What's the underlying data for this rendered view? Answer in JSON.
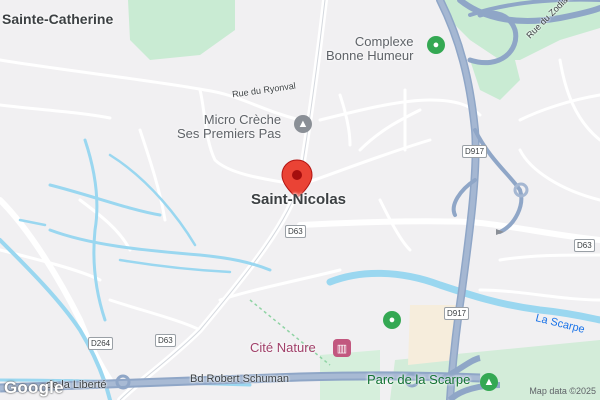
{
  "map": {
    "places": {
      "sainte_catherine": "Sainte-Catherine",
      "saint_nicolas": "Saint-Nicolas"
    },
    "pois": {
      "complexe": "Complexe\nBonne Humeur",
      "micro_creche": "Micro Crèche\nSes Premiers Pas",
      "cite_nature": "Cité Nature",
      "parc_scarpe": "Parc de la Scarpe"
    },
    "streets": {
      "rue_ryonval": "Rue du Ryonval",
      "rue_zodiaque": "Rue du Zodiaque",
      "bd_schuman": "Bd Robert Schuman",
      "liberte_partial": "de la Liberté"
    },
    "water": {
      "la_scarpe": "La Scarpe"
    },
    "shields": {
      "d917_top": "D917",
      "d917_bottom": "D917",
      "d63_center": "D63",
      "d63_right": "D63",
      "d63_bottom": "D63",
      "d264": "D264"
    },
    "attribution": "Map data ©2025",
    "brand": "Google",
    "colors": {
      "background": "#f1f0f2",
      "water": "#9ad7f0",
      "park": "#c5ead0",
      "highway": "#8fa6c7",
      "marker": "#ea4335",
      "poi_green": "#34a853",
      "poi_gray": "#8a8f96",
      "poi_pink": "#c2577f"
    }
  }
}
